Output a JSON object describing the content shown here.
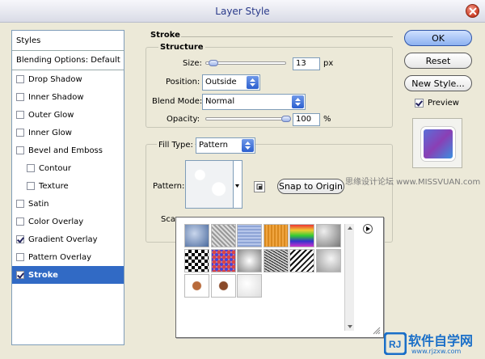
{
  "window": {
    "title": "Layer Style"
  },
  "styles": {
    "header": "Styles",
    "blending": "Blending Options: Default",
    "items": [
      {
        "label": "Drop Shadow",
        "checked": false,
        "indent": false,
        "active": false
      },
      {
        "label": "Inner Shadow",
        "checked": false,
        "indent": false,
        "active": false
      },
      {
        "label": "Outer Glow",
        "checked": false,
        "indent": false,
        "active": false
      },
      {
        "label": "Inner Glow",
        "checked": false,
        "indent": false,
        "active": false
      },
      {
        "label": "Bevel and Emboss",
        "checked": false,
        "indent": false,
        "active": false
      },
      {
        "label": "Contour",
        "checked": false,
        "indent": true,
        "active": false
      },
      {
        "label": "Texture",
        "checked": false,
        "indent": true,
        "active": false
      },
      {
        "label": "Satin",
        "checked": false,
        "indent": false,
        "active": false
      },
      {
        "label": "Color Overlay",
        "checked": false,
        "indent": false,
        "active": false
      },
      {
        "label": "Gradient Overlay",
        "checked": true,
        "indent": false,
        "active": false
      },
      {
        "label": "Pattern Overlay",
        "checked": false,
        "indent": false,
        "active": false
      },
      {
        "label": "Stroke",
        "checked": true,
        "indent": false,
        "active": true
      }
    ]
  },
  "stroke": {
    "section_title": "Stroke",
    "structure_title": "Structure",
    "size_label": "Size:",
    "size_value": "13",
    "size_unit": "px",
    "size_slider_fraction": 0.1,
    "position_label": "Position:",
    "position_value": "Outside",
    "blend_label": "Blend Mode:",
    "blend_value": "Normal",
    "opacity_label": "Opacity:",
    "opacity_value": "100",
    "opacity_unit": "%",
    "opacity_slider_fraction": 1.0,
    "fill_type_label": "Fill Type:",
    "fill_type_value": "Pattern",
    "pattern_label": "Pattern:",
    "scale_label": "Sca",
    "snap_button": "Snap to Origin"
  },
  "buttons": {
    "ok": "OK",
    "reset": "Reset",
    "new_style": "New Style...",
    "preview_label": "Preview",
    "preview_checked": true
  },
  "picker": {
    "swatches": [
      "blue-bubbles",
      "gray-noise",
      "blue-weave",
      "orange-grain",
      "rainbow-stripes",
      "gray-rocks",
      "checkerboard",
      "colored-dots",
      "gray-clouds",
      "black-noise",
      "zigzag",
      "gray-marble",
      "butterfly-a",
      "butterfly-b",
      "white-marble"
    ]
  },
  "watermark": "思缘设计论坛 www.MISSVUAN.com",
  "logo": {
    "text": "软件自学网",
    "url": "www.rjzxw.com",
    "mark": "RJ"
  }
}
